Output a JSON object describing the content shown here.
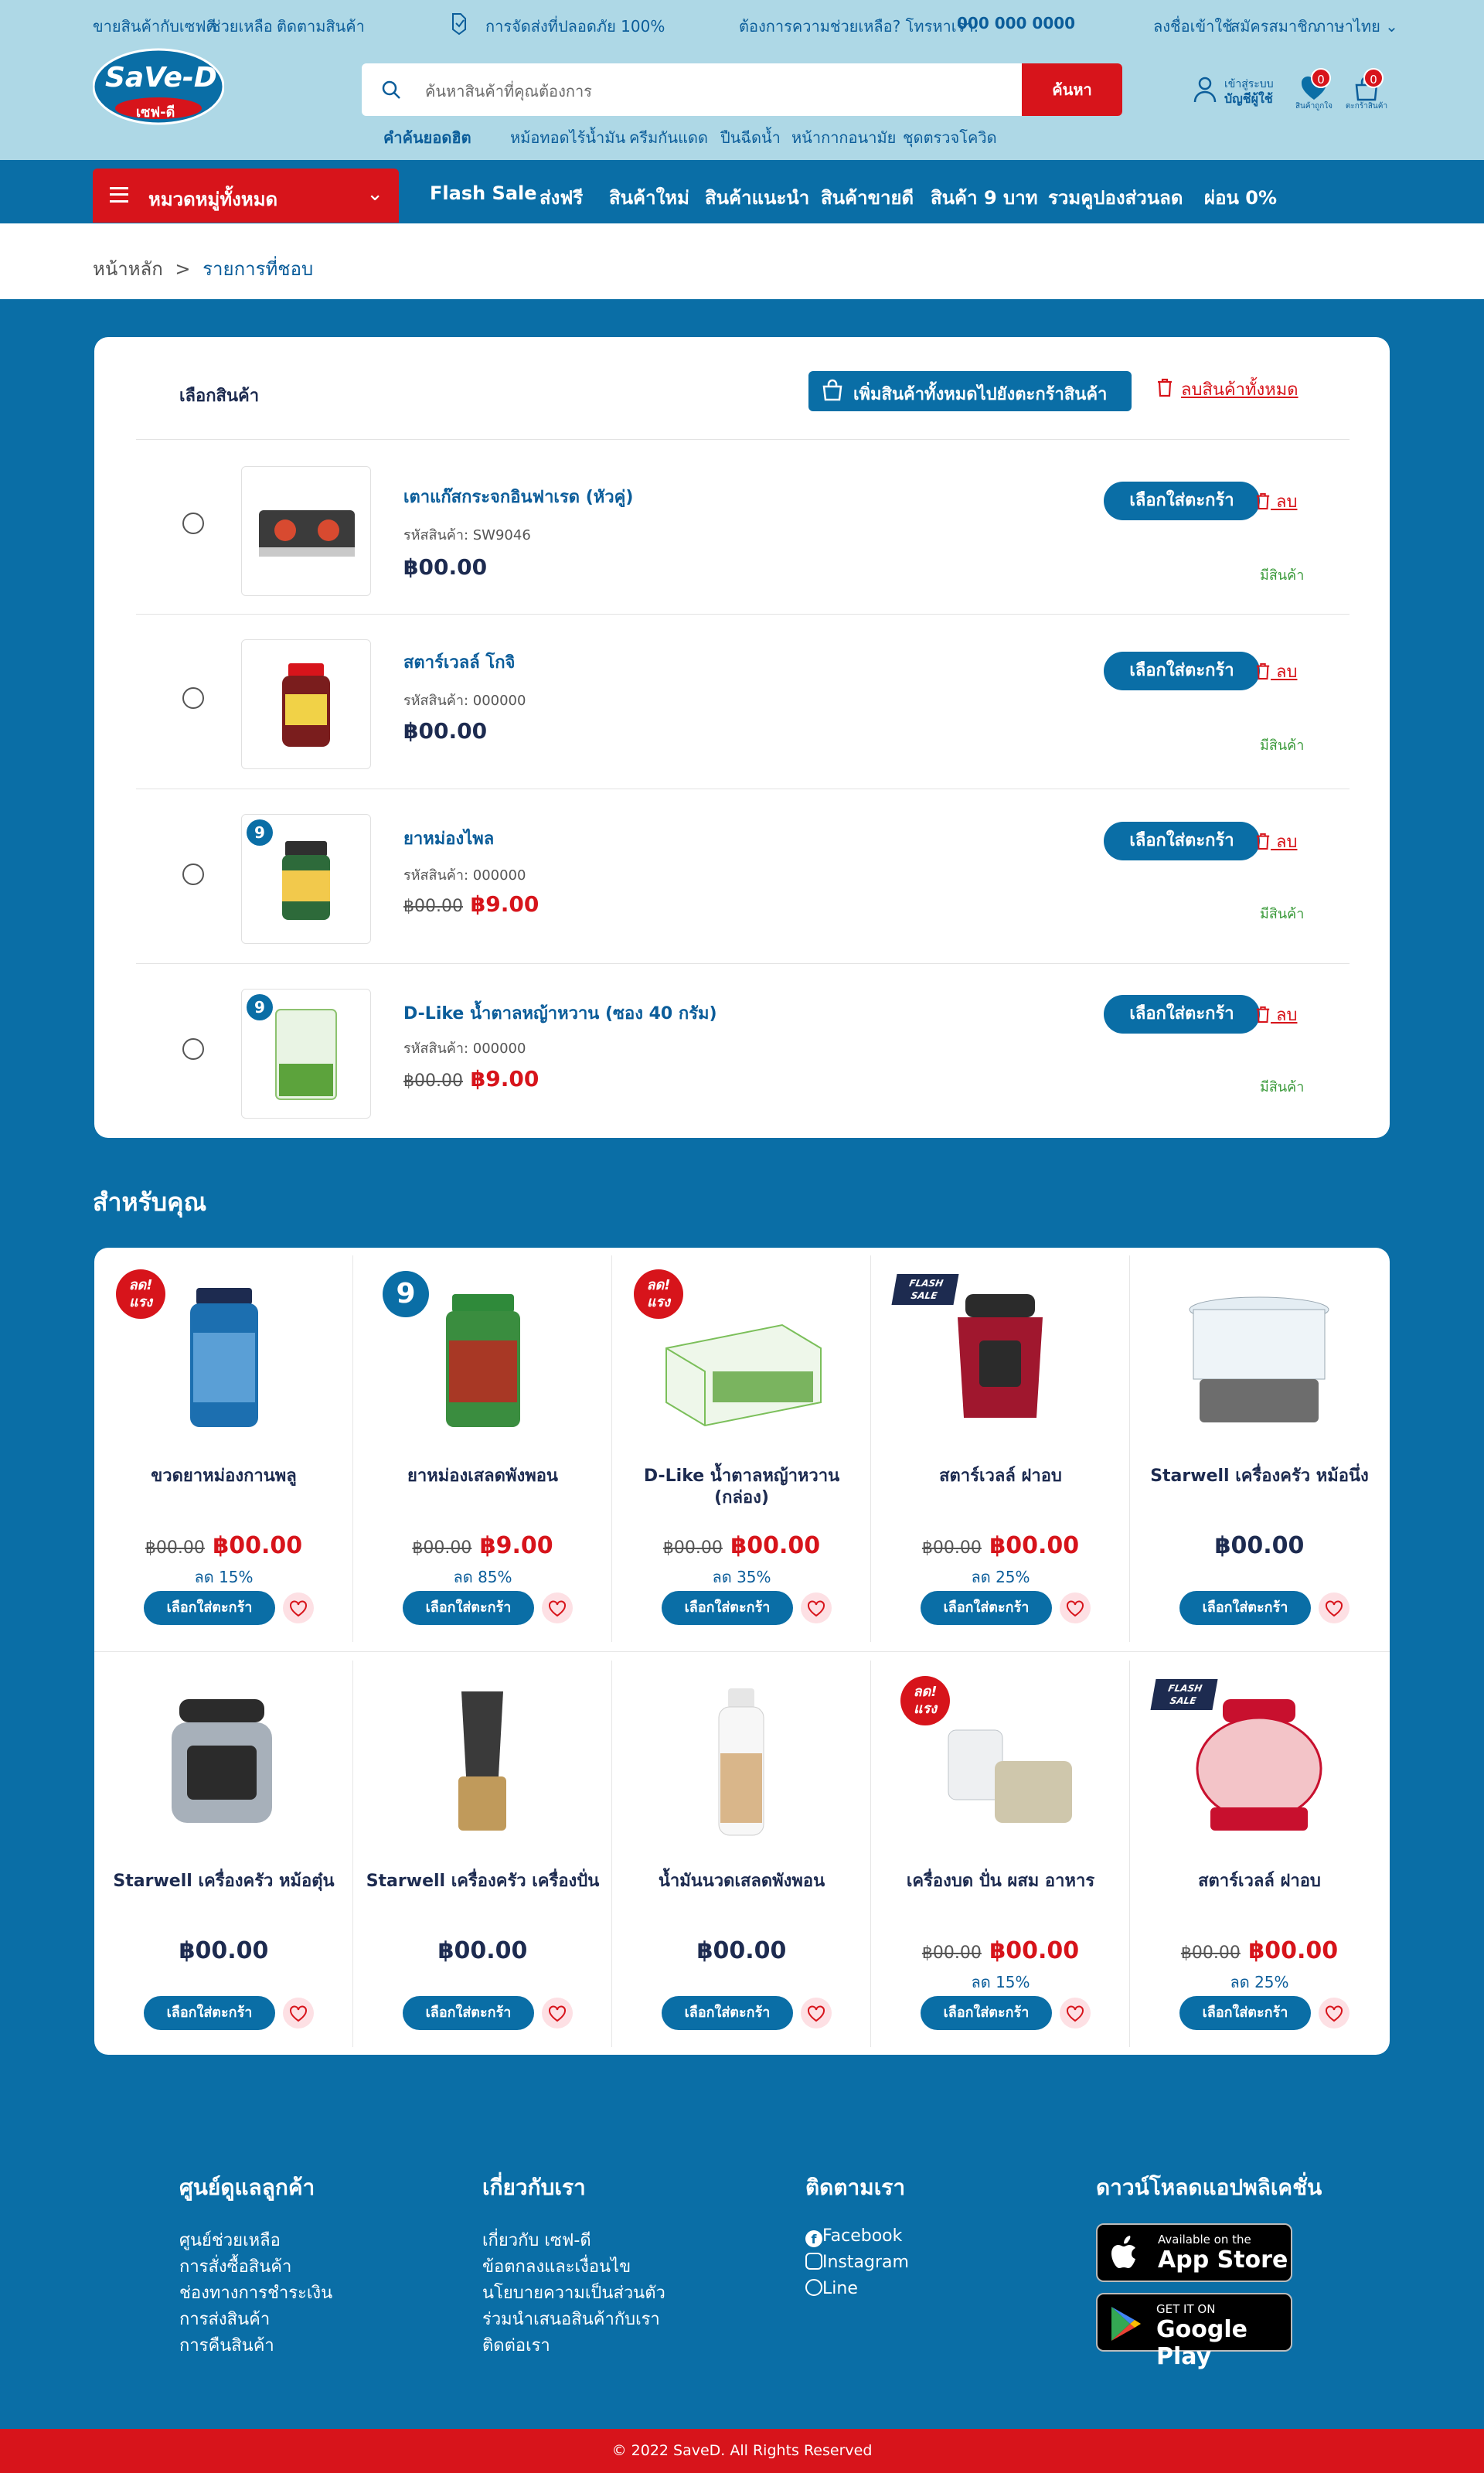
{
  "topbar": {
    "sell": "ขายสินค้ากับเซฟดี",
    "help": "ช่วยเหลือ",
    "track": "ติดตามสินค้า",
    "shipping": "การจัดส่งที่ปลอดภัย 100%",
    "contact": "ต้องการความช่วยเหลือ? โทรหาเรา:",
    "phone": "000 000 0000",
    "login": "ลงชื่อเข้าใช้",
    "register": "สมัครสมาชิก",
    "language": "ภาษาไทย"
  },
  "logo": {
    "text": "SaVe-D",
    "sub": "เซฟ-ดี"
  },
  "search": {
    "placeholder": "ค้นหาสินค้าที่คุณต้องการ",
    "button": "ค้นหา"
  },
  "hot": {
    "label": "คำค้นยอดฮิต",
    "items": [
      "หม้อทอดไร้น้ำมัน",
      "ครีมกันแดด",
      "ปืนฉีดน้ำ",
      "หน้ากากอนามัย",
      "ชุดตรวจโควิด"
    ]
  },
  "account": {
    "line1": "เข้าสู่ระบบ",
    "line2": "บัญชีผู้ใช้"
  },
  "wish": {
    "label": "สินค้าถูกใจ",
    "count": "0"
  },
  "cart": {
    "label": "ตะกร้าสินค้า",
    "count": "0"
  },
  "nav": {
    "all": "หมวดหมู่ทั้งหมด",
    "links": [
      "Flash Sale",
      "ส่งฟรี",
      "สินค้าใหม่",
      "สินค้าแนะนำ",
      "สินค้าขายดี",
      "สินค้า 9 บาท",
      "รวมคูปองส่วนลด",
      "ผ่อน 0%"
    ]
  },
  "breadcrumb": {
    "home": "หน้าหลัก",
    "sep": ">",
    "current": "รายการที่ชอบ"
  },
  "wishlist": {
    "select": "เลือกสินค้า",
    "add_all": "เพิ่มสินค้าทั้งหมดไปยังตะกร้าสินค้า",
    "delete_all": "ลบสินค้าทั้งหมด",
    "add_btn": "เลือกใส่ตะกร้า",
    "delete": "ลบ",
    "stock": "มีสินค้า",
    "items": [
      {
        "name": "เตาแก๊สกระจกอินฟาเรด (หัวคู่)",
        "sku": "รหัสสินค้า: SW9046",
        "old": "",
        "price": "฿00.00"
      },
      {
        "name": "สตาร์เวลล์ โกจิ",
        "sku": "รหัสสินค้า: 000000",
        "old": "",
        "price": "฿00.00"
      },
      {
        "name": "ยาหม่องไพล",
        "sku": "รหัสสินค้า: 000000",
        "old": "฿00.00",
        "price": "฿9.00"
      },
      {
        "name": "D-Like น้ำตาลหญ้าหวาน (ซอง 40 กรัม)",
        "sku": "รหัสสินค้า: 000000",
        "old": "฿00.00",
        "price": "฿9.00"
      }
    ]
  },
  "foryou": {
    "title": "สำหรับคุณ",
    "add_btn": "เลือกใส่ตะกร้า",
    "products": [
      {
        "name": "ขวดยาหม่องกานพลู",
        "old": "฿00.00",
        "price": "฿00.00",
        "disc": "ลด 15%",
        "badge": "ลด! แรง"
      },
      {
        "name": "ยาหม่องเสลดพังพอน",
        "old": "฿00.00",
        "price": "฿9.00",
        "disc": "ลด 85%",
        "badge": "9"
      },
      {
        "name": "D-Like น้ำตาลหญ้าหวาน (กล่อง)",
        "old": "฿00.00",
        "price": "฿00.00",
        "disc": "ลด 35%",
        "badge": "ลด! แรง"
      },
      {
        "name": "สตาร์เวลล์ ฝาอบ",
        "old": "฿00.00",
        "price": "฿00.00",
        "disc": "ลด 25%",
        "badge": "FLASH SALE"
      },
      {
        "name": "Starwell เครื่องครัว หม้อนึ่ง",
        "old": "",
        "price": "฿00.00",
        "disc": "",
        "badge": ""
      },
      {
        "name": "Starwell เครื่องครัว หม้อตุ๋น",
        "old": "",
        "price": "฿00.00",
        "disc": "",
        "badge": ""
      },
      {
        "name": "Starwell เครื่องครัว เครื่องปั่น",
        "old": "",
        "price": "฿00.00",
        "disc": "",
        "badge": ""
      },
      {
        "name": "น้ำมันนวดเสลดพังพอน",
        "old": "",
        "price": "฿00.00",
        "disc": "",
        "badge": ""
      },
      {
        "name": "เครื่องบด ปั่น ผสม อาหาร",
        "old": "฿00.00",
        "price": "฿00.00",
        "disc": "ลด 15%",
        "badge": "ลด! แรง"
      },
      {
        "name": "สตาร์เวลล์ ฝาอบ",
        "old": "฿00.00",
        "price": "฿00.00",
        "disc": "ลด 25%",
        "badge": "FLASH SALE"
      }
    ]
  },
  "footer": {
    "care": {
      "title": "ศูนย์ดูแลลูกค้า",
      "links": [
        "ศูนย์ช่วยเหลือ",
        "การสั่งซื้อสินค้า",
        "ช่องทางการชำระเงิน",
        "การส่งสินค้า",
        "การคืนสินค้า"
      ]
    },
    "about": {
      "title": "เกี่ยวกับเรา",
      "links": [
        "เกี่ยวกับ เซฟ-ดี",
        "ข้อตกลงและเงื่อนไข",
        "นโยบายความเป็นส่วนตัว",
        "ร่วมนำเสนอสินค้ากับเรา",
        "ติดต่อเรา"
      ]
    },
    "follow": {
      "title": "ติดตามเรา",
      "links": [
        "Facebook",
        "Instagram",
        "Line"
      ]
    },
    "app": {
      "title": "ดาวน์โหลดแอปพลิเคชั่น",
      "appstore_small": "Available on the",
      "appstore": "App Store",
      "gplay_small": "GET IT ON",
      "gplay": "Google Play"
    },
    "copyright": "© 2022 SaveD. All Rights Reserved"
  },
  "colors": {
    "primary": "#0a6ea6",
    "accent": "#d7141b",
    "topbar": "#aed8e6"
  }
}
